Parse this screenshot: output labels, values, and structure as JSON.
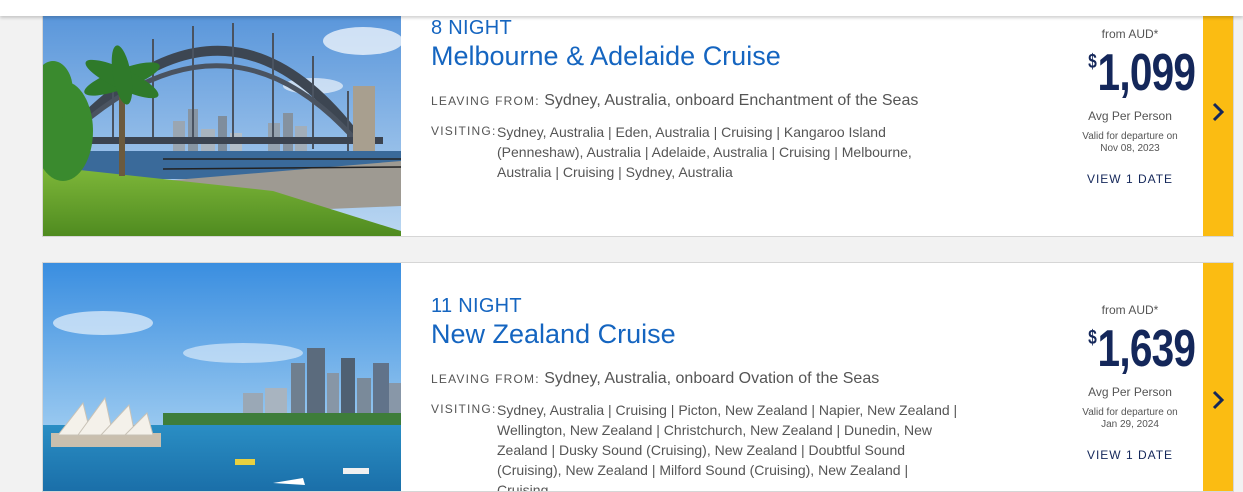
{
  "cruises": [
    {
      "nights": "8 NIGHT",
      "title": "Melbourne & Adelaide Cruise",
      "leaving_label": "LEAVING FROM:",
      "leaving_value": "Sydney, Australia, onboard Enchantment of the Seas",
      "visiting_label": "VISITING:",
      "visiting_value": "Sydney, Australia  |  Eden, Australia  |  Cruising  |  Kangaroo Island (Penneshaw), Australia  |  Adelaide, Australia  |  Cruising  |  Melbourne, Australia  |  Cruising  |  Sydney, Australia",
      "from_label": "from AUD*",
      "currency": "$",
      "price": "1,099",
      "avg_label": "Avg Per Person",
      "valid_line1": "Valid for departure on",
      "valid_line2": "Nov 08, 2023",
      "view_dates": "VIEW 1 DATE",
      "image": "sydney-harbour-bridge-photo",
      "arrow_icon": "chevron-right-icon"
    },
    {
      "nights": "11 NIGHT",
      "title": "New Zealand Cruise",
      "leaving_label": "LEAVING FROM:",
      "leaving_value": "Sydney, Australia, onboard Ovation of the Seas",
      "visiting_label": "VISITING:",
      "visiting_value": "Sydney, Australia  |  Cruising  |  Picton, New Zealand  |  Napier, New Zealand  |  Wellington, New Zealand  |  Christchurch, New Zealand  |  Dunedin, New Zealand  |  Dusky Sound (Cruising), New Zealand  |  Doubtful Sound (Cruising), New Zealand  |  Milford Sound (Cruising), New Zealand  |  Cruising",
      "from_label": "from AUD*",
      "currency": "$",
      "price": "1,639",
      "avg_label": "Avg Per Person",
      "valid_line1": "Valid for departure on",
      "valid_line2": "Jan 29, 2024",
      "view_dates": "VIEW 1 DATE",
      "image": "sydney-opera-house-photo",
      "arrow_icon": "chevron-right-icon"
    }
  ],
  "colors": {
    "title_blue": "#1565c0",
    "price_navy": "#14275a",
    "accent_yellow": "#fbbc12"
  }
}
